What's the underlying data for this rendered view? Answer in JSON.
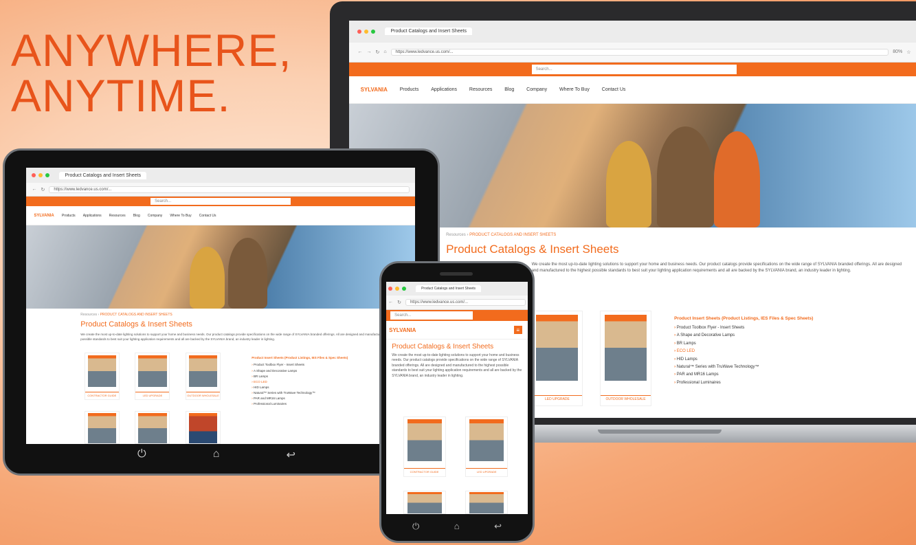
{
  "headline": {
    "line1": "ANYWHERE,",
    "line2": "ANYTIME."
  },
  "browser": {
    "tab_title": "Product Catalogs and Insert Sheets",
    "url": "https://www.ledvance.us.com/...",
    "zoom": "80%",
    "search_placeholder": "Search..."
  },
  "site": {
    "logo": "SYLVANIA",
    "nav": [
      "Products",
      "Applications",
      "Resources",
      "Blog",
      "Company",
      "Where To Buy",
      "Contact Us"
    ],
    "breadcrumb_root": "Resources",
    "breadcrumb_current": "PRODUCT CATALOGS AND INSERT SHEETS",
    "page_title": "Product Catalogs & Insert Sheets",
    "intro": "We create the most up-to-date lighting solutions to support your home and business needs. Our product catalogs provide specifications on the wide range of SYLVANIA branded offerings. All are designed and manufactured to the highest possible standards to best suit your lighting application requirements and all are backed by the SYLVANIA brand, an industry leader in lighting.",
    "insert_heading": "Product Insert Sheets (Product Listings, IES Files & Spec Sheets)",
    "insert_items": [
      "Product Toolbox Flyer - Insert Sheets",
      "A Shape and Decorative Lamps",
      "BR Lamps",
      "ECO LED",
      "HID Lamps",
      "Natural™ Series with TruWave Technology™",
      "PAR and MR16 Lamps",
      "Professional Luminaires"
    ],
    "card_labels": [
      "CONTRACTOR GUIDE",
      "LED UPGRADE",
      "OUTDOOR WHOLESALE"
    ]
  },
  "colors": {
    "accent": "#f26b1d",
    "headline": "#e8541b"
  },
  "icons": {
    "tablet_nav": [
      "power-icon",
      "home-icon",
      "back-icon"
    ]
  }
}
